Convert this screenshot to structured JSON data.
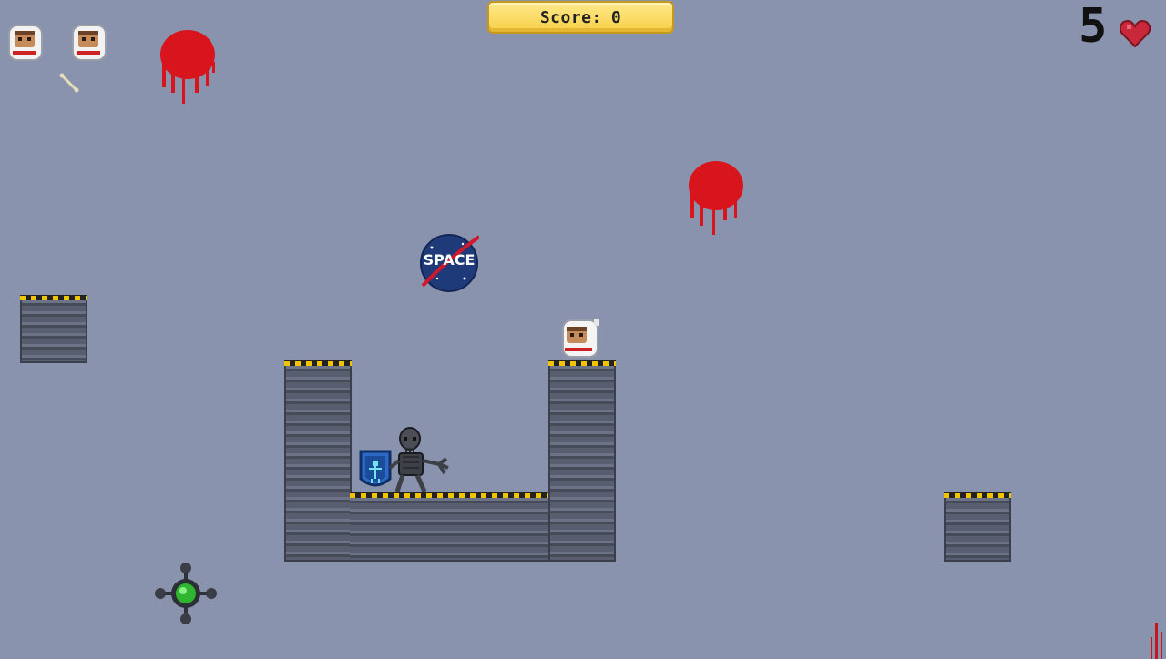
{
  "hud": {
    "score_label": "Score:",
    "score_value": "0",
    "lives_count": "5",
    "lives_icon": "heart-icon"
  },
  "badge": {
    "text": "SPACE"
  },
  "colors": {
    "background": "#8a93ad",
    "score_pill": "#f7cf48",
    "hazard_stripe": "#f0c400",
    "blood": "#d8141c",
    "heart": "#c8283a"
  }
}
